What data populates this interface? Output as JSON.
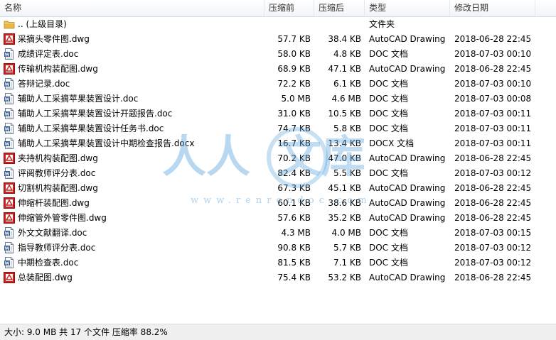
{
  "columns": {
    "name": "名称",
    "size": "压缩前",
    "compressed": "压缩后",
    "type": "类型",
    "modified": "修改日期"
  },
  "rows": [
    {
      "icon": "folder-icon",
      "name": ".. (上级目录)",
      "size": "",
      "compressed": "",
      "type": "文件夹",
      "date": ""
    },
    {
      "icon": "dwg-file-icon",
      "name": "采摘头零件图.dwg",
      "size": "57.7 KB",
      "compressed": "38.4 KB",
      "type": "AutoCAD Drawing",
      "date": "2018-06-28 22:45"
    },
    {
      "icon": "doc-file-icon",
      "name": "成绩评定表.doc",
      "size": "58.0 KB",
      "compressed": "4.8 KB",
      "type": "DOC 文档",
      "date": "2018-07-03 00:10"
    },
    {
      "icon": "dwg-file-icon",
      "name": "传输机构装配图.dwg",
      "size": "68.9 KB",
      "compressed": "47.1 KB",
      "type": "AutoCAD Drawing",
      "date": "2018-06-28 22:45"
    },
    {
      "icon": "doc-file-icon",
      "name": "答辩记录.doc",
      "size": "72.2 KB",
      "compressed": "6.1 KB",
      "type": "DOC 文档",
      "date": "2018-07-03 00:10"
    },
    {
      "icon": "doc-file-icon",
      "name": "辅助人工采摘苹果装置设计.doc",
      "size": "5.0 MB",
      "compressed": "4.6 MB",
      "type": "DOC 文档",
      "date": "2018-07-03 00:08"
    },
    {
      "icon": "doc-file-icon",
      "name": "辅助人工采摘苹果装置设计开题报告.doc",
      "size": "31.0 KB",
      "compressed": "10.5 KB",
      "type": "DOC 文档",
      "date": "2018-07-03 00:11"
    },
    {
      "icon": "doc-file-icon",
      "name": "辅助人工采摘苹果装置设计任务书.doc",
      "size": "74.7 KB",
      "compressed": "5.8 KB",
      "type": "DOC 文档",
      "date": "2018-07-03 00:11"
    },
    {
      "icon": "doc-file-icon",
      "name": "辅助人工采摘苹果装置设计中期检查报告.docx",
      "size": "16.7 KB",
      "compressed": "13.4 KB",
      "type": "DOCX 文档",
      "date": "2018-07-03 00:11"
    },
    {
      "icon": "dwg-file-icon",
      "name": "夹持机构装配图.dwg",
      "size": "70.2 KB",
      "compressed": "47.0 KB",
      "type": "AutoCAD Drawing",
      "date": "2018-06-28 22:45"
    },
    {
      "icon": "doc-file-icon",
      "name": "评阅教师评分表.doc",
      "size": "82.4 KB",
      "compressed": "5.5 KB",
      "type": "DOC 文档",
      "date": "2018-07-03 00:12"
    },
    {
      "icon": "dwg-file-icon",
      "name": "切割机构装配图.dwg",
      "size": "67.3 KB",
      "compressed": "45.1 KB",
      "type": "AutoCAD Drawing",
      "date": "2018-06-28 22:45"
    },
    {
      "icon": "dwg-file-icon",
      "name": "伸缩杆装配图.dwg",
      "size": "60.1 KB",
      "compressed": "38.6 KB",
      "type": "AutoCAD Drawing",
      "date": "2018-06-28 22:45"
    },
    {
      "icon": "dwg-file-icon",
      "name": "伸缩管外管零件图.dwg",
      "size": "57.6 KB",
      "compressed": "35.2 KB",
      "type": "AutoCAD Drawing",
      "date": "2018-06-28 22:45"
    },
    {
      "icon": "doc-file-icon",
      "name": "外文文献翻译.doc",
      "size": "4.3 MB",
      "compressed": "4.0 MB",
      "type": "DOC 文档",
      "date": "2018-07-03 00:15"
    },
    {
      "icon": "doc-file-icon",
      "name": "指导教师评分表.doc",
      "size": "90.8 KB",
      "compressed": "5.7 KB",
      "type": "DOC 文档",
      "date": "2018-07-03 00:12"
    },
    {
      "icon": "doc-file-icon",
      "name": "中期检查表.doc",
      "size": "81.5 KB",
      "compressed": "7.1 KB",
      "type": "DOC 文档",
      "date": "2018-07-03 00:12"
    },
    {
      "icon": "dwg-file-icon",
      "name": "总装配图.dwg",
      "size": "75.4 KB",
      "compressed": "53.2 KB",
      "type": "AutoCAD Drawing",
      "date": "2018-06-28 22:45"
    }
  ],
  "status": "大小: 9.0 MB 共 17 个文件 压缩率 88.2%",
  "watermark": {
    "chars_left": "人人",
    "chars_right": "文库",
    "url": "www.renrendoc.com"
  },
  "colors": {
    "watermark": "#5fa8de",
    "dwg_icon": "#cc1f1f",
    "doc_icon": "#2b5797",
    "folder_icon": "#e8b84a"
  }
}
